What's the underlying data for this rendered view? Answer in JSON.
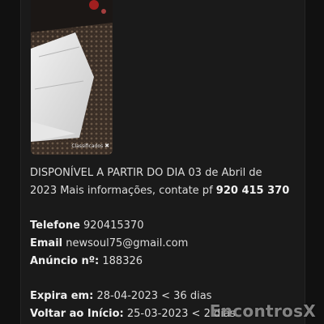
{
  "photo": {
    "caption": "Classificados",
    "caption_icon": "close-x-icon"
  },
  "ad": {
    "description_line1_prefix": "DISPONÍVEL A PARTIR DO DIA ",
    "description_line1_date": "03 de Abril de",
    "description_line2_prefix": "2023 Mais informações, contate pf ",
    "description_line2_phone": "920 415 370",
    "phone_label": "Telefone",
    "phone_value": "920415370",
    "email_label": "Email",
    "email_value": "newsoul75@gmail.com",
    "ad_number_label": "Anúncio nº:",
    "ad_number_value": "188326",
    "expires_label": "Expira em:",
    "expires_value": "28-04-2023 < 36 dias",
    "back_label": "Voltar ao Início:",
    "back_value": "25-03-2023 < 2 dias"
  },
  "watermark": "EncontrosX",
  "colors": {
    "background": "#111111",
    "card": "#1a1a1a",
    "text": "#dcdcdc"
  }
}
